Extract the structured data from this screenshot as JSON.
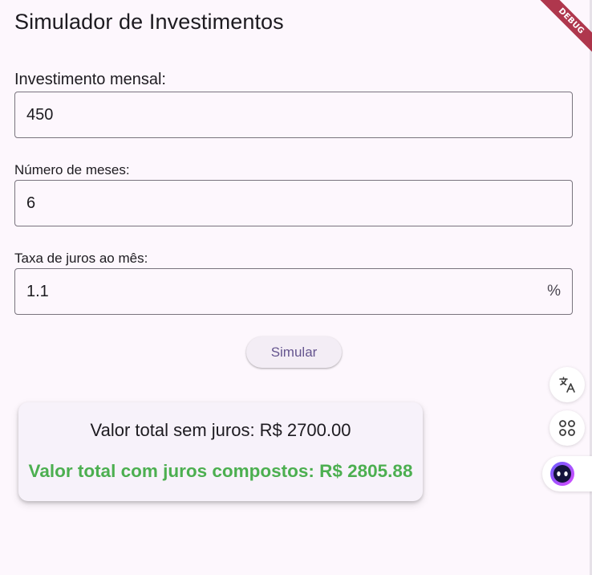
{
  "app": {
    "title": "Simulador de Investimentos",
    "debug_banner": "DEBUG"
  },
  "form": {
    "monthly_investment": {
      "label": "Investimento mensal:",
      "value": "450"
    },
    "months": {
      "label": "Número de meses:",
      "value": "6"
    },
    "interest_rate": {
      "label": "Taxa de juros ao mês:",
      "value": "1.1",
      "suffix": "%"
    },
    "simulate_label": "Simular"
  },
  "result": {
    "simple_total": "Valor total sem juros: R$ 2700.00",
    "compound_total": "Valor total com juros compostos: R$ 2805.88",
    "compound_color": "#4caf50"
  },
  "side_toolbar": {
    "items": [
      {
        "icon": "translate-icon"
      },
      {
        "icon": "apps-icon"
      },
      {
        "icon": "assistant-icon"
      }
    ]
  },
  "colors": {
    "background": "#fdf7fd",
    "primary": "#65558f",
    "debug_ribbon": "#a2162f"
  }
}
